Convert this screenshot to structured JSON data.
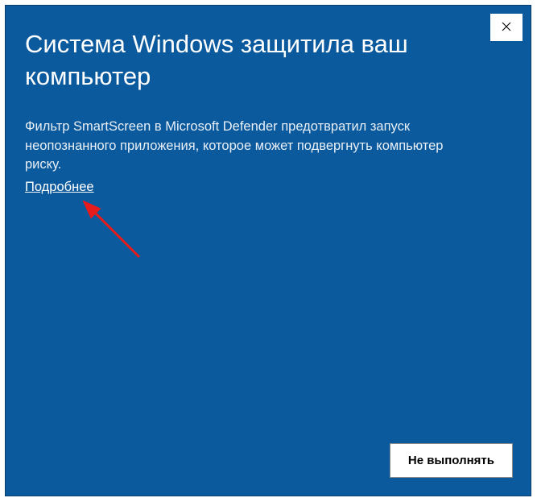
{
  "dialog": {
    "title": "Система Windows защитила ваш компьютер",
    "body": "Фильтр SmartScreen в Microsoft Defender предотвратил запуск неопознанного приложения, которое может подвергнуть компьютер риску.",
    "more_link": "Подробнее",
    "dont_run": "Не выполнять"
  }
}
